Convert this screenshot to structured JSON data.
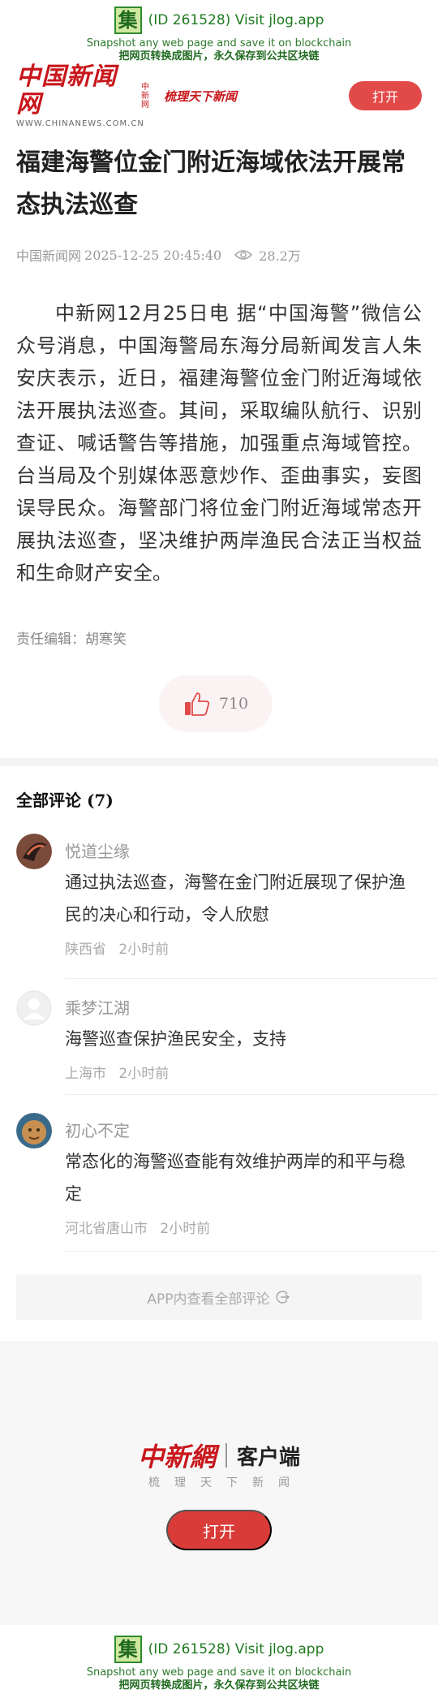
{
  "jlog": {
    "logo_char": "集",
    "line1": "(ID 261528) Visit jlog.app",
    "line2": "Snapshot any web page and save it on blockchain",
    "line3": "把网页转换成图片，永久保存到公共区块链"
  },
  "header": {
    "brand": "中国新闻网",
    "brand_url": "WWW.CHINANEWS.COM.CN",
    "brand_vertical": "中新网",
    "slogan": "梳理天下新闻",
    "open_label": "打开"
  },
  "article": {
    "title": "福建海警位金门附近海域依法开展常态执法巡查",
    "source": "中国新闻网",
    "datetime": "2025-12-25 20:45:40",
    "views": "28.2万",
    "body": "中新网12月25日电 据“中国海警”微信公众号消息，中国海警局东海分局新闻发言人朱安庆表示，近日，福建海警位金门附近海域依法开展执法巡查。其间，采取编队航行、识别查证、喊话警告等措施，加强重点海域管控。台当局及个别媒体恶意炒作、歪曲事实，妄图误导民众。海警部门将位金门附近海域常态开展执法巡查，坚决维护两岸渔民合法正当权益和生命财产安全。",
    "editor": "责任编辑：胡寒笑",
    "likes": "710"
  },
  "comments": {
    "heading": "全部评论",
    "count": "(7)",
    "items": [
      {
        "name": "悦道尘缘",
        "text": "通过执法巡查，海警在金门附近展现了保护渔民的决心和行动，令人欣慰",
        "location": "陕西省",
        "time": "2小时前"
      },
      {
        "name": "乘梦江湖",
        "text": "海警巡查保护渔民安全，支持",
        "location": "上海市",
        "time": "2小时前"
      },
      {
        "name": "初心不定",
        "text": "常态化的海警巡查能有效维护两岸的和平与稳定",
        "location": "河北省唐山市",
        "time": "2小时前"
      }
    ],
    "view_all": "APP内查看全部评论"
  },
  "promo": {
    "brand": "中新網",
    "client": "客户端",
    "subtitle": "梳理天下新闻",
    "open_label": "打开"
  },
  "colors": {
    "brand_red": "#c8171c",
    "button_red": "#e24a4a",
    "jlog_green": "#1f7a1f"
  }
}
